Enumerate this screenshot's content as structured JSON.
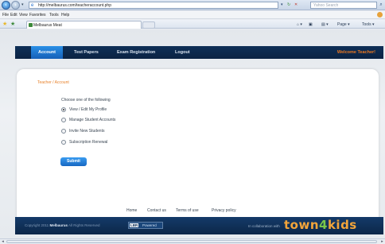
{
  "browser": {
    "url": "http://melbaurus.com/teacheraccount.php",
    "search_placeholder": "Yahoo Search",
    "menu": [
      "File",
      "Edit",
      "View",
      "Favorites",
      "Tools",
      "Help"
    ],
    "tab_title": "Melbaurus Meat",
    "cmd_page": "Page ▾",
    "cmd_tools": "Tools ▾"
  },
  "site": {
    "nav": [
      "Account",
      "Test Papers",
      "Exam Registration",
      "Logout"
    ],
    "welcome": "Welcome Teacher!",
    "breadcrumb": "Teacher / Account",
    "prompt": "Choose one of the following",
    "options": [
      "View / Edit My Profile",
      "Manage Student Accounts",
      "Invite New Students",
      "Subscription Renewal"
    ],
    "selected_option": 0,
    "submit_label": "Submit",
    "footer_links": [
      "Home",
      "Contact us",
      "Terms of use",
      "Privacy policy"
    ],
    "copyright_prefix": "Copyright 2011",
    "copyright_brand": "Melbaurus",
    "copyright_suffix": "All Rights Reserved",
    "powered_logo": "LBR",
    "powered_text": "Powered",
    "collab_text": "In collaboration with",
    "brand_logo_a": "town",
    "brand_logo_b": "4",
    "brand_logo_c": "kids"
  },
  "colors": {
    "nav_bg": "#0e2f57",
    "active_tab": "#1f7ad6",
    "accent_orange": "#f0791f"
  }
}
